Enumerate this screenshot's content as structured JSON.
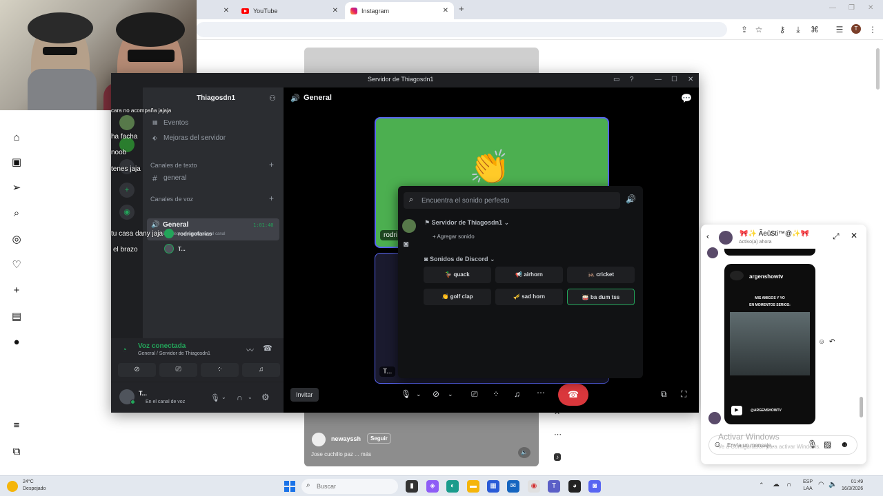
{
  "browser": {
    "tabs": [
      {
        "label": ""
      },
      {
        "label": "YouTube"
      },
      {
        "label": "Instagram"
      }
    ],
    "new_tab": "+",
    "profile_initial": "T"
  },
  "instagram": {
    "post": {
      "author": "newayssh",
      "follow": "Seguir",
      "caption": "Jose cuchillo paz ... más"
    },
    "dm": {
      "contact_name": "🎀✨ Ãeû$ti™@✨🎀",
      "status": "Activo(a) ahora",
      "shared_post": {
        "author": "argenshowtv",
        "text_line1": "MIS AMIGOS Y YO",
        "text_line2": "EN MOMENTOS SERIOS:",
        "handle": "@ARGENSHOWTV"
      },
      "message_placeholder": "Envía un mensaje..."
    }
  },
  "windows_watermark": {
    "title": "Activar Windows",
    "subtitle": "Ve a Configuración para activar Windows."
  },
  "stream_chat": [
    "rodrigofarias",
    "cara no acompaña jajaja",
    "ha facha",
    "noob",
    "tenes jaja",
    "tu casa dany jaja",
    "el brazo"
  ],
  "discord": {
    "window_title": "Servidor de Thiagosdn1",
    "server_name": "Thiagosdn1",
    "channels": {
      "events": "Eventos",
      "boosts": "Mejoras del servidor",
      "text_category": "Canales de texto",
      "text_channel": "general",
      "voice_category": "Canales de voz",
      "voice_channel": "General",
      "voice_timer": "1:01:40",
      "voice_status": "Establece un estado para el canal",
      "members": [
        "rodrigofarias",
        "T..."
      ]
    },
    "voice_panel": {
      "status": "Voz conectada",
      "location": "General / Servidor de Thiagosdn1"
    },
    "user_panel": {
      "name": "T...",
      "status": "En el canal de voz"
    },
    "main": {
      "channel_title": "General",
      "tile_labels": [
        "rodri",
        "T..."
      ],
      "invite": "Invitar"
    },
    "soundboard": {
      "search_placeholder": "Encuentra el sonido perfecto",
      "server_section": "Servidor de Thiagosdn1",
      "add_sound": "Agregar sonido",
      "discord_section": "Sonidos de Discord",
      "sounds": [
        {
          "label": "quack",
          "emoji": "🦆"
        },
        {
          "label": "airhorn",
          "emoji": "📢"
        },
        {
          "label": "cricket",
          "emoji": "🦗"
        },
        {
          "label": "golf clap",
          "emoji": "👏"
        },
        {
          "label": "sad horn",
          "emoji": "🎺"
        },
        {
          "label": "ba dum tss",
          "emoji": "🥁"
        }
      ]
    }
  },
  "taskbar": {
    "temperature": "24°C",
    "weather": "Despejado",
    "search_placeholder": "Buscar",
    "lang_line1": "ESP",
    "lang_line2": "LAA",
    "time": "01:49",
    "date": "16/3/2026"
  },
  "colors": {
    "discord_bg": "#1e1f22",
    "discord_sidebar": "#2b2d31",
    "discord_green": "#23a55a",
    "discord_red": "#da373c",
    "discord_blurple": "#5865f2",
    "tile_green": "#4caf50"
  }
}
